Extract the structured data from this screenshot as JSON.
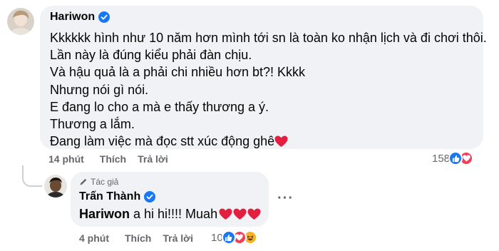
{
  "comment1": {
    "author": "Hariwon",
    "lines": [
      "Kkkkkk hình như 10 năm hơn mình tới sn là toàn ko nhận lịch và đi chơi thôi.",
      "Lần này là đúng kiểu phải đàn chịu.",
      "Và hậu quả là a phải chi nhiều hơn bt?! Kkkk",
      "Nhưng nói gì nói.",
      "E đang lo cho a mà e thấy thương a ý.",
      "Thương a lắm.",
      "Đang làm việc mà đọc stt xúc động ghê"
    ],
    "time": "14 phút",
    "like_label": "Thích",
    "reply_label": "Trả lời",
    "reaction_count": "158",
    "reactions": [
      "like-icon",
      "love-icon"
    ]
  },
  "comment2": {
    "author_badge": "Tác giả",
    "author": "Trấn Thành",
    "mention": "Hariwon",
    "text": " a hi hi!!!! Muah",
    "time": "4 phút",
    "like_label": "Thích",
    "reply_label": "Trả lời",
    "reaction_count": "10",
    "reactions": [
      "like-icon",
      "love-icon",
      "haha-icon"
    ]
  },
  "colors": {
    "bubble_bg": "#f0f2f5",
    "like_blue": "#1877f2",
    "heart_red": "#e41e3f",
    "meta_gray": "#65676b"
  }
}
